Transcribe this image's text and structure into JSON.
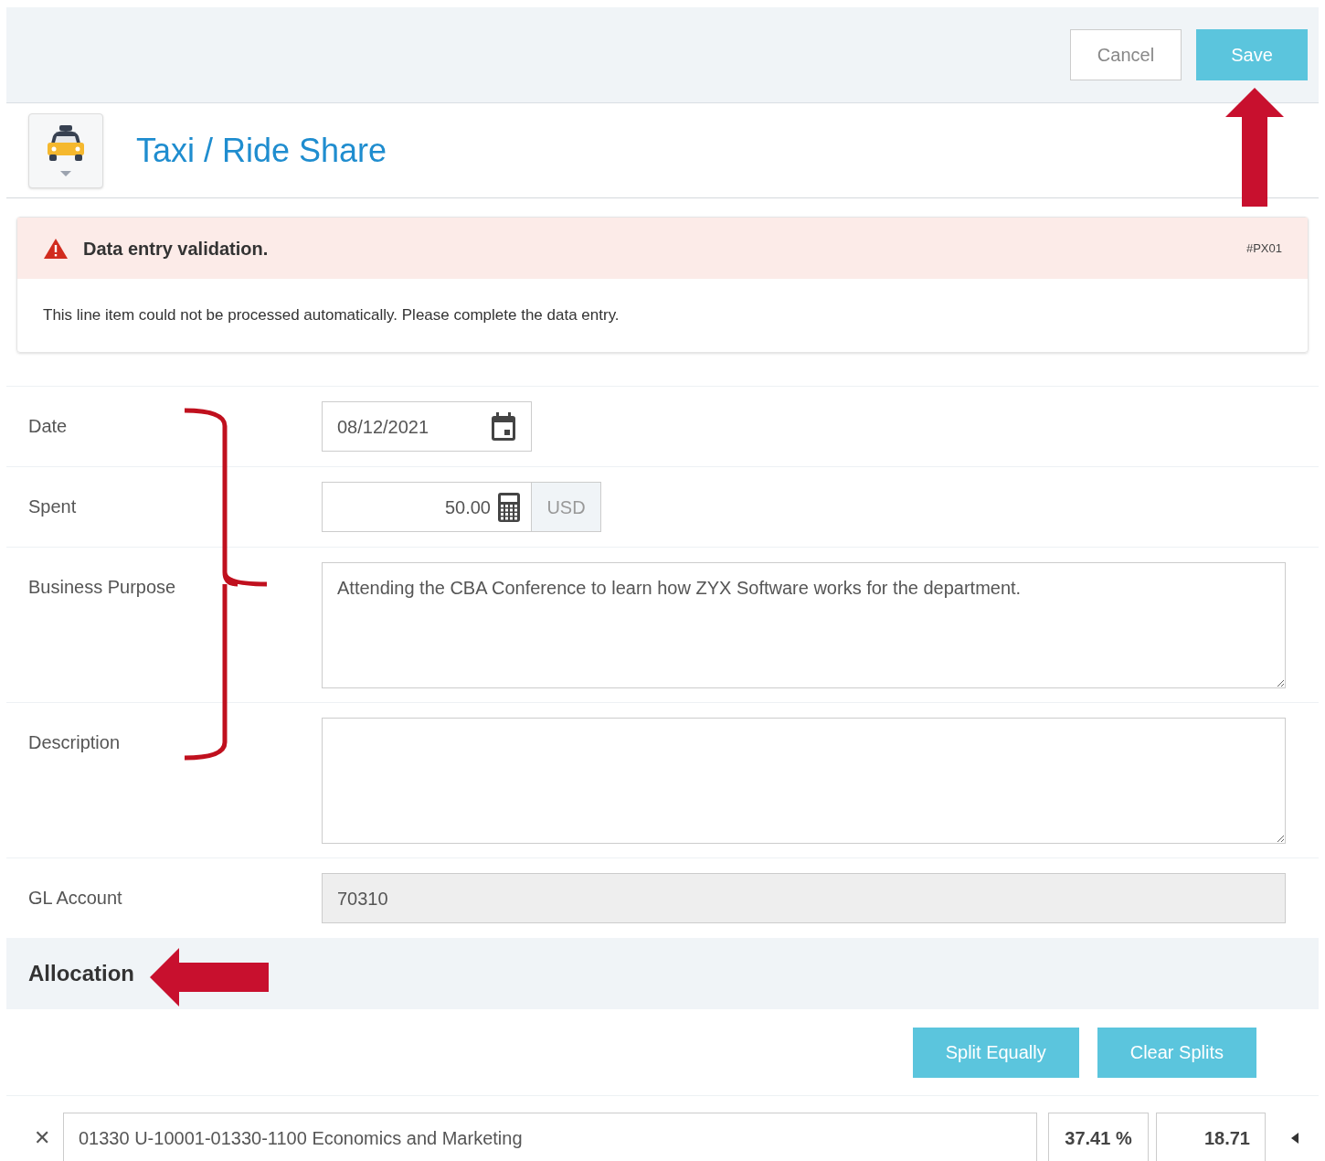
{
  "toolbar": {
    "buttons": [
      {
        "label": "Cancel",
        "kind": "secondary"
      },
      {
        "label": "Save",
        "kind": "primary"
      }
    ]
  },
  "header": {
    "title": "Taxi / Ride Share"
  },
  "alert": {
    "title": "Data entry validation.",
    "code": "#PX01",
    "message": "This line item could not be processed automatically. Please complete the data entry."
  },
  "form": {
    "date": {
      "label": "Date",
      "value": "08/12/2021"
    },
    "spent": {
      "label": "Spent",
      "value": "50.00",
      "currency": "USD"
    },
    "business_purpose": {
      "label": "Business Purpose",
      "value": "Attending the CBA Conference to learn how ZYX Software works for the department."
    },
    "description": {
      "label": "Description"
    },
    "gl_account": {
      "label": "GL Account",
      "value": "70310",
      "disabled": true
    }
  },
  "allocation": {
    "title": "Allocation",
    "buttons": [
      "Split Equally",
      "Clear Splits"
    ],
    "rows": [
      {
        "remove": "✕",
        "account": "01330 U-10001-01330-1100 Economics and Marketing",
        "percent": "37.41 %",
        "amount": "18.71"
      }
    ]
  }
}
